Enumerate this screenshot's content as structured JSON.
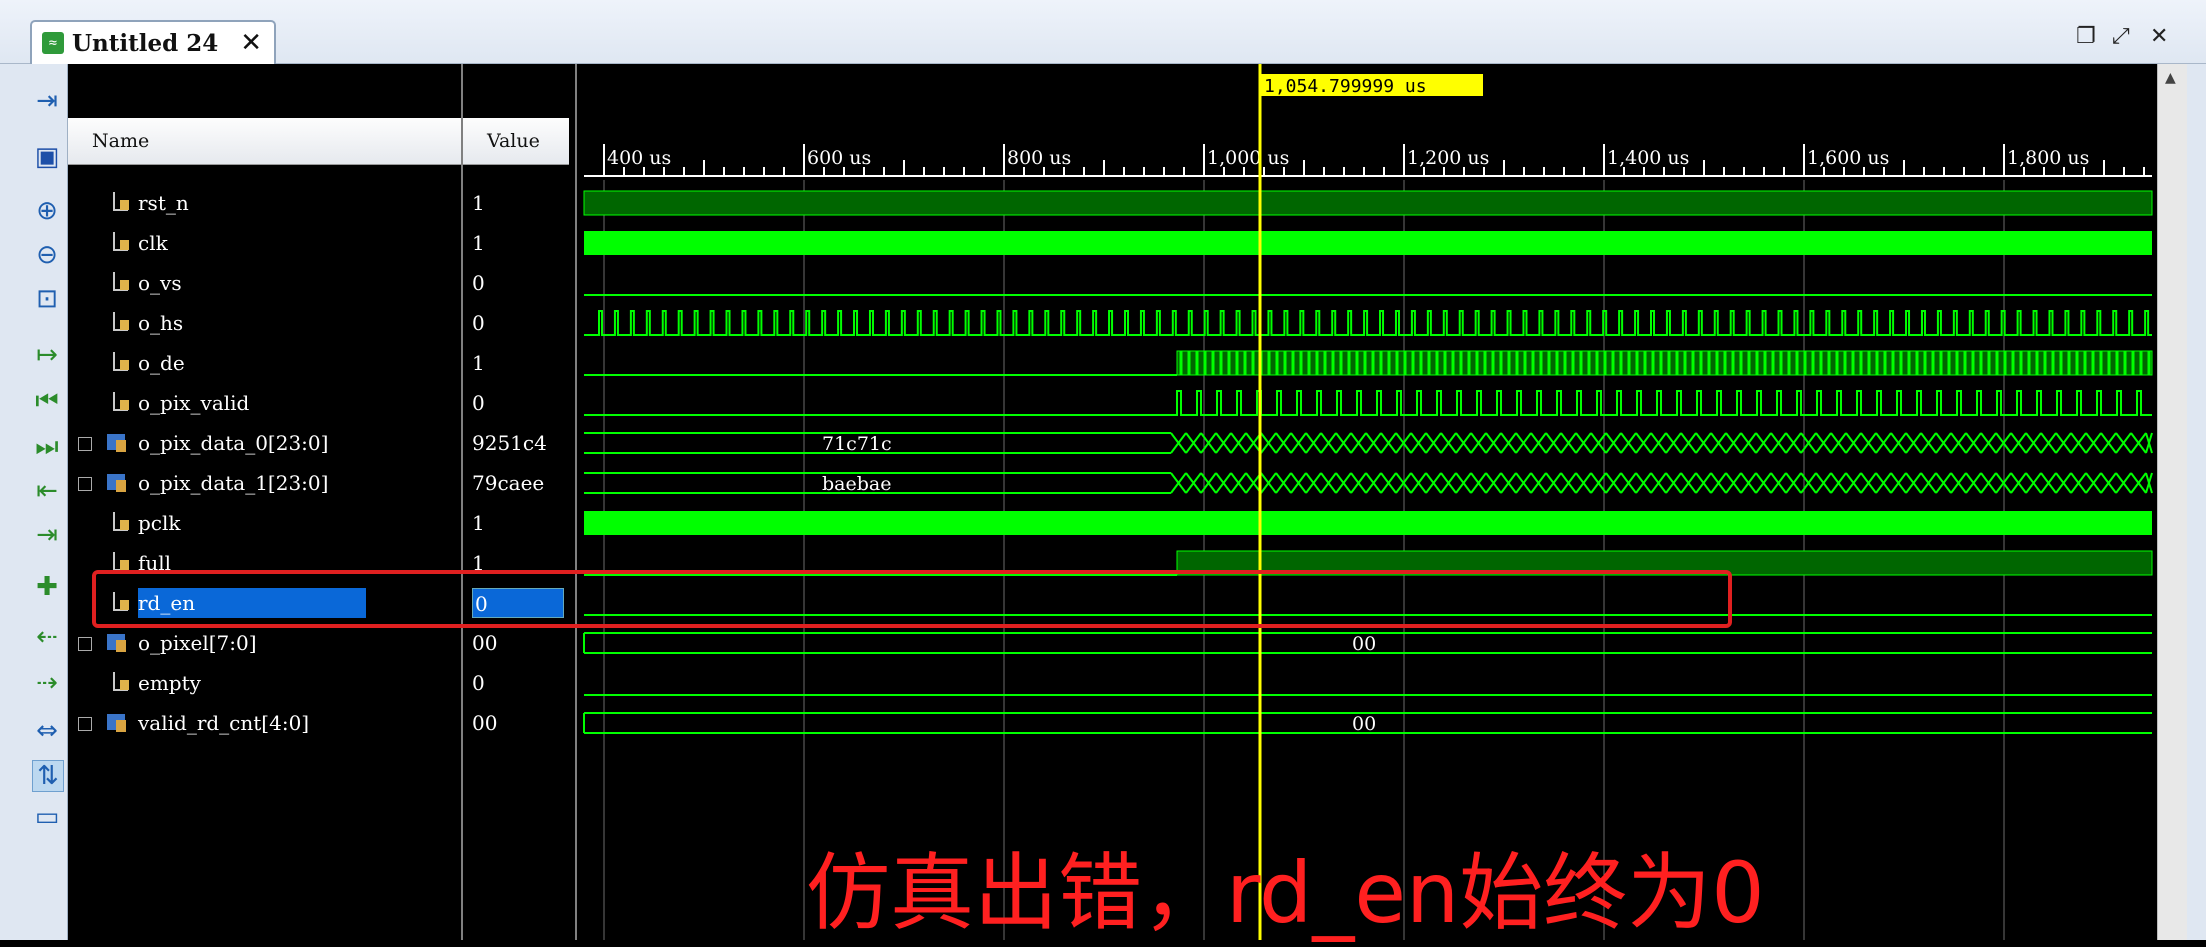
{
  "window": {
    "tab_title": "Untitled 24",
    "tab_close": "✕",
    "restore_icon": "restore-icon",
    "maximize_icon": "maximize-icon",
    "close_icon": "close-icon"
  },
  "toolbar": {
    "icons": [
      "zoom-fit-scope-icon",
      "save-icon",
      "zoom-in-icon",
      "zoom-out-icon",
      "zoom-full-icon",
      "go-to-cursor-icon",
      "go-to-start-icon",
      "go-to-end-icon",
      "previous-transition-icon",
      "next-transition-icon",
      "add-marker-icon",
      "previous-marker-icon",
      "next-marker-icon",
      "swap-cursors-icon",
      "snap-to-transition-icon",
      "floating-ruler-icon"
    ]
  },
  "columns": {
    "name": "Name",
    "value": "Value"
  },
  "signals": [
    {
      "name": "rst_n",
      "value": "1",
      "bus": false
    },
    {
      "name": "clk",
      "value": "1",
      "bus": false
    },
    {
      "name": "o_vs",
      "value": "0",
      "bus": false
    },
    {
      "name": "o_hs",
      "value": "0",
      "bus": false
    },
    {
      "name": "o_de",
      "value": "1",
      "bus": false
    },
    {
      "name": "o_pix_valid",
      "value": "0",
      "bus": false
    },
    {
      "name": "o_pix_data_0[23:0]",
      "value": "9251c4",
      "bus": true
    },
    {
      "name": "o_pix_data_1[23:0]",
      "value": "79caee",
      "bus": true
    },
    {
      "name": "pclk",
      "value": "1",
      "bus": false
    },
    {
      "name": "full",
      "value": "1",
      "bus": false
    },
    {
      "name": "rd_en",
      "value": "0",
      "bus": false,
      "selected": true
    },
    {
      "name": "o_pixel[7:0]",
      "value": "00",
      "bus": true
    },
    {
      "name": "empty",
      "value": "0",
      "bus": false
    },
    {
      "name": "valid_rd_cnt[4:0]",
      "value": "00",
      "bus": true
    }
  ],
  "timeline": {
    "cursor_label": "1,054.799999 us",
    "cursor_color": "#ffff00",
    "ticks": [
      "400 us",
      "600 us",
      "800 us",
      "1,000 us",
      "1,200 us",
      "1,400 us",
      "1,600 us",
      "1,800 us"
    ]
  },
  "bus_labels": {
    "o_pix_data_0": "71c71c",
    "o_pix_data_1": "baebae",
    "o_pixel": "00",
    "valid_rd_cnt": "00"
  },
  "colors": {
    "wave": "#00ff00",
    "wave_dim": "#006600",
    "selection": "#0a68d8",
    "annotation": "#ff2020"
  },
  "annotation": {
    "text": "仿真出错，rd_en始终为0"
  }
}
